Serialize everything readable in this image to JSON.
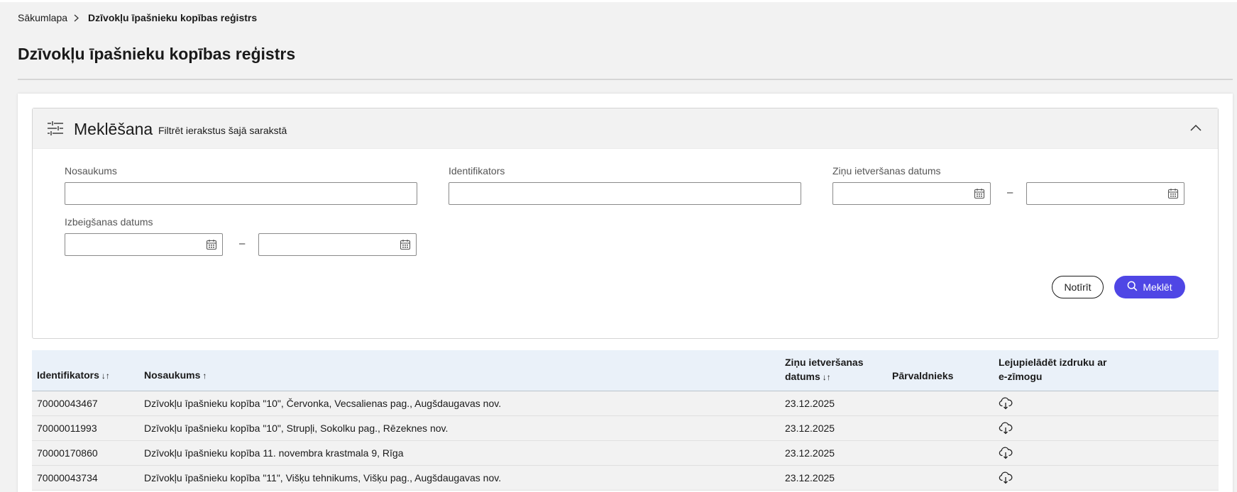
{
  "breadcrumb": {
    "home": "Sākumlapa",
    "current": "Dzīvokļu īpašnieku kopības reģistrs"
  },
  "page_title": "Dzīvokļu īpašnieku kopības reģistrs",
  "search_panel": {
    "title": "Meklēšana",
    "subtitle": "Filtrēt ierakstus šajā sarakstā",
    "fields": {
      "name_label": "Nosaukums",
      "name_value": "",
      "id_label": "Identifikators",
      "id_value": "",
      "info_date_label": "Ziņu ietveršanas datums",
      "end_date_label": "Izbeigšanas datums",
      "range_separator": "–"
    },
    "buttons": {
      "clear": "Notīrīt",
      "search": "Meklēt"
    }
  },
  "table": {
    "headers": {
      "id": "Identifikators",
      "id_sort": "↓↑",
      "name": "Nosaukums",
      "name_sort": "↑",
      "date_line1": "Ziņu ietveršanas",
      "date_line2": "datums",
      "date_sort": "↓↑",
      "manager": "Pārvaldnieks",
      "download_line1": "Lejupielādēt izdruku ar",
      "download_line2": "e-zīmogu"
    },
    "rows": [
      {
        "id": "70000043467",
        "name": "Dzīvokļu īpašnieku kopība \"10\", Červonka, Vecsalienas pag., Augšdaugavas nov.",
        "date": "23.12.2025",
        "manager": ""
      },
      {
        "id": "70000011993",
        "name": "Dzīvokļu īpašnieku kopība \"10\", Strupļi, Sokolku pag., Rēzeknes nov.",
        "date": "23.12.2025",
        "manager": ""
      },
      {
        "id": "70000170860",
        "name": "Dzīvokļu īpašnieku kopība 11. novembra krastmala 9, Rīga",
        "date": "23.12.2025",
        "manager": ""
      },
      {
        "id": "70000043734",
        "name": "Dzīvokļu īpašnieku kopība \"11\", Višķu tehnikums, Višķu pag., Augšdaugavas nov.",
        "date": "23.12.2025",
        "manager": ""
      }
    ]
  },
  "colors": {
    "accent": "#4f46e5",
    "table_header_bg": "#eaf1f9",
    "page_bg": "#f2f2f2"
  },
  "icons": [
    "chevron-right-icon",
    "filter-sliders-icon",
    "chevron-up-icon",
    "calendar-icon",
    "search-icon",
    "cloud-download-icon"
  ]
}
